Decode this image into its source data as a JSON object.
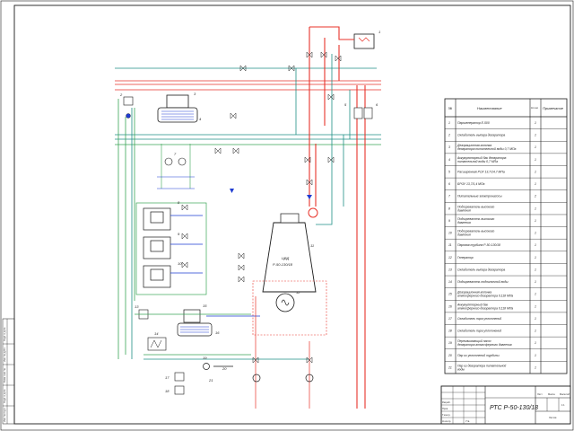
{
  "title_block": {
    "code": "РТС Р-50-130/18",
    "small_labels": [
      "Лист",
      "Масса",
      "Масштаб",
      "1:1",
      "Листов",
      "Разраб.",
      "Пров.",
      "Т.контр.",
      "Н.контр.",
      "Утв."
    ]
  },
  "spec": {
    "headers": [
      "№",
      "Наименование",
      "Кол-во",
      "Примечание"
    ],
    "rows": [
      {
        "n": "1",
        "name": "Парогенератор Е-500",
        "qty": "1"
      },
      {
        "n": "2",
        "name": "Охладитель выпара деаэратора",
        "qty": "1"
      },
      {
        "n": "3",
        "name": "Деаэрационная колонка деаэратора питательной воды 0,7 МПа",
        "qty": "1"
      },
      {
        "n": "4",
        "name": "Аккумуляторный бак деаэратора питательной воды 0,7 МПа",
        "qty": "1"
      },
      {
        "n": "5",
        "name": "Расширенная РОУ 13,7/14,7 МПа",
        "qty": "1"
      },
      {
        "n": "6",
        "name": "БРОУ 13,7/1,4 МПа",
        "qty": "1"
      },
      {
        "n": "7",
        "name": "Питательные электронасосы",
        "qty": "2"
      },
      {
        "n": "8",
        "name": "Подогреватель высокого давления",
        "qty": "1"
      },
      {
        "n": "9",
        "name": "Подогреватель высокого давления",
        "qty": "1"
      },
      {
        "n": "10",
        "name": "Подогреватель высокого давления",
        "qty": "1"
      },
      {
        "n": "11",
        "name": "Паровая турбина Р-50-130/18",
        "qty": "1"
      },
      {
        "n": "12",
        "name": "Генератор",
        "qty": "1"
      },
      {
        "n": "13",
        "name": "Охладитель выпара деаэратора",
        "qty": "1"
      },
      {
        "n": "14",
        "name": "Подогреватель подпиточной воды",
        "qty": "1"
      },
      {
        "n": "15",
        "name": "Деаэрационная колонка атмосферного деаэратора 0,118 МПа",
        "qty": "1"
      },
      {
        "n": "16",
        "name": "Аккумуляторный бак атмосферного деаэратора 0,118 МПа",
        "qty": "1"
      },
      {
        "n": "17",
        "name": "Охладитель пара уплотнений",
        "qty": "1"
      },
      {
        "n": "18",
        "name": "Охладитель пара уплотнений",
        "qty": "1"
      },
      {
        "n": "19",
        "name": "Перекачивающий насос деаэратора атмосферного давления",
        "qty": "1"
      },
      {
        "n": "20",
        "name": "Пар из уплотнений турбины",
        "qty": "1"
      },
      {
        "n": "21",
        "name": "Пар из деаэратора питательной воды",
        "qty": "1"
      }
    ]
  },
  "scheme": {
    "turbine_label": "ЦВД",
    "turbine_model": "Р-50-130/18",
    "tags": [
      "1",
      "2",
      "3",
      "4",
      "5",
      "6",
      "7",
      "8",
      "9",
      "10",
      "11",
      "12",
      "13",
      "14",
      "15",
      "16",
      "17",
      "18",
      "19",
      "20",
      "21"
    ]
  },
  "side_stamp": [
    "Подп. и дата",
    "Инв. № дубл.",
    "Взам. инв. №",
    "Подп. и дата",
    "Инв. № подл."
  ],
  "colors": {
    "steam_red": "#e8332a",
    "water_green": "#3aa556",
    "teal": "#1f8f86",
    "blue": "#1e3bd1",
    "ink": "#1a1a1a"
  }
}
